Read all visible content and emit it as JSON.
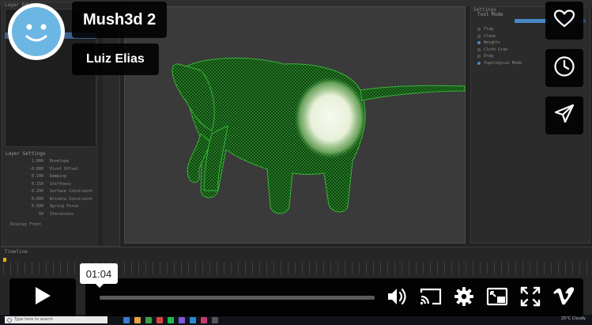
{
  "video": {
    "title": "Mush3d 2",
    "author": "Luiz Elias",
    "current_time": "01:04",
    "progress": 0.0
  },
  "app": {
    "left_panel_title": "Layer Editor",
    "layer_settings": {
      "title": "Layer Settings",
      "rows": [
        {
          "value": "1.000",
          "label": "Envelope"
        },
        {
          "value": "-0.000",
          "label": "Pivot Offset"
        },
        {
          "value": "0.100",
          "label": "Damping"
        },
        {
          "value": "0.150",
          "label": "Stiffness"
        },
        {
          "value": "0.200",
          "label": "Surface Constraint"
        },
        {
          "value": "0.000",
          "label": "Wrinkle Constraint"
        },
        {
          "value": "0.500",
          "label": "Spring Force"
        },
        {
          "value": "50",
          "label": "Iterations"
        }
      ],
      "footer": "Display Front"
    },
    "settings_panel_title": "Settings",
    "tool_mode_label": "Tool Mode",
    "tool_options": [
      {
        "label": "Flag",
        "selected": false
      },
      {
        "label": "Clone",
        "selected": false
      },
      {
        "label": "Weights",
        "selected": true
      },
      {
        "label": "Cloth Grab",
        "selected": false
      },
      {
        "label": "Drag",
        "selected": false
      },
      {
        "label": "Topological Mode",
        "selected": true
      }
    ],
    "timeline_title": "Timeline",
    "taskbar": {
      "search_placeholder": "Type here to search",
      "tray": "25°C  Cloudy"
    }
  },
  "colors": {
    "mesh_green": "#2e8b2e",
    "highlight": "#f4f8ee",
    "accent_blue": "#4a88c8",
    "overlay_bg": "#000000",
    "avatar_blue": "#6cb6e3"
  },
  "icons": {
    "like": "heart-icon",
    "watch_later": "clock-icon",
    "share": "paper-plane-icon",
    "play": "play-icon",
    "volume": "volume-icon",
    "cast": "cast-icon",
    "settings": "gear-icon",
    "pip": "picture-in-picture-icon",
    "fullscreen": "fullscreen-icon",
    "vimeo": "vimeo-logo"
  }
}
